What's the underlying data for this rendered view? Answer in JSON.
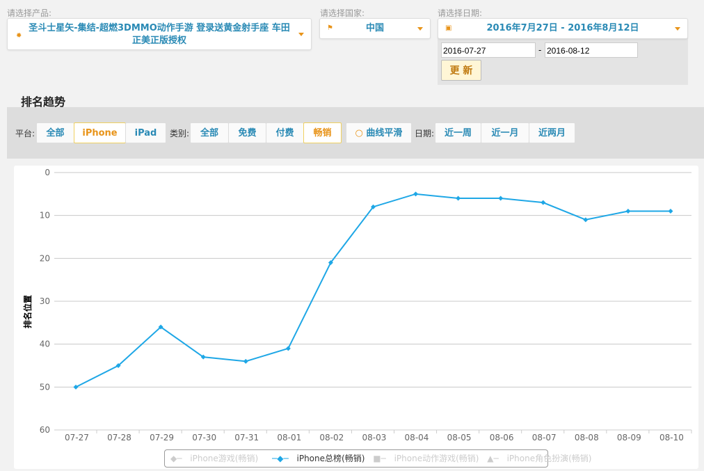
{
  "product": {
    "label": "请选择产品:",
    "value_line1": "圣斗士星矢-集结-超燃3DMMO动作手游 登录送黄金射手座 车田",
    "value_line2": "正美正版授权"
  },
  "country": {
    "label": "请选择国家:",
    "value": "中国"
  },
  "date": {
    "label": "请选择日期:",
    "value": "2016年7月27日 - 2016年8月12日",
    "start": "2016-07-27",
    "sep": "-",
    "end": "2016-08-12",
    "update": "更 新"
  },
  "section_title": "排名趋势",
  "filters": {
    "platform_label": "平台:",
    "platform": [
      "全部",
      "iPhone",
      "iPad"
    ],
    "category_label": "类别:",
    "category": [
      "全部",
      "免费",
      "付费",
      "畅销"
    ],
    "smooth": "曲线平滑",
    "date_label": "日期:",
    "dates": [
      "近一周",
      "近一月",
      "近两月"
    ]
  },
  "colors": {
    "accent": "#2a8ab5",
    "active": "#e8941a",
    "series": "#1ea7e6"
  },
  "chart_data": {
    "type": "line",
    "ylabel": "排名位置",
    "ylim": [
      0,
      60
    ],
    "y_reversed": true,
    "yticks": [
      0,
      10,
      20,
      30,
      40,
      50,
      60
    ],
    "categories": [
      "07-27",
      "07-28",
      "07-29",
      "07-30",
      "07-31",
      "08-01",
      "08-02",
      "08-03",
      "08-04",
      "08-05",
      "08-06",
      "08-07",
      "08-08",
      "08-09",
      "08-10"
    ],
    "series": [
      {
        "name": "iPhone总榜(畅销)",
        "values": [
          50,
          45,
          36,
          43,
          44,
          41,
          21,
          8,
          5,
          6,
          6,
          7,
          11,
          9,
          9
        ]
      }
    ],
    "legend": [
      "iPhone游戏(畅销)",
      "iPhone总榜(畅销)",
      "iPhone动作游戏(畅销)",
      "iPhone角色扮演(畅销)"
    ],
    "legend_position": "bottom"
  }
}
